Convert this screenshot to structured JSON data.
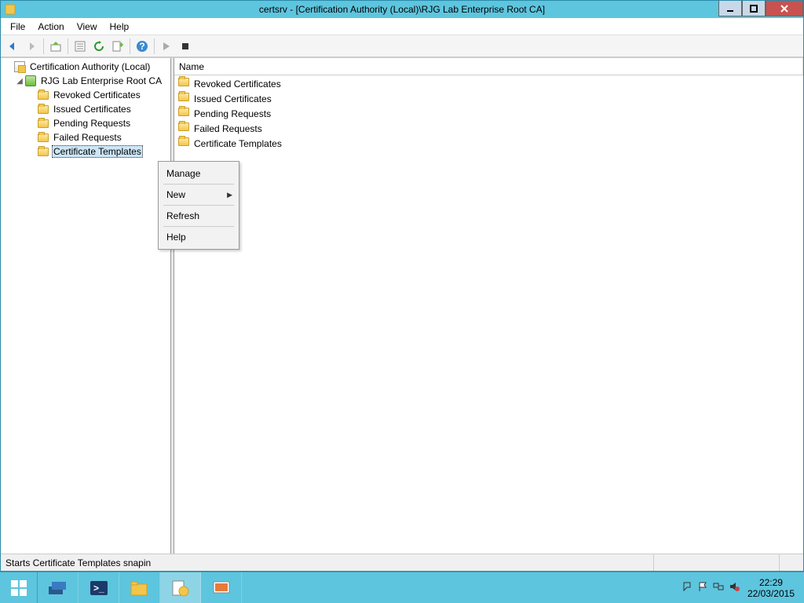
{
  "title": "certsrv - [Certification Authority (Local)\\RJG Lab Enterprise Root CA]",
  "menubar": {
    "file": "File",
    "action": "Action",
    "view": "View",
    "help": "Help"
  },
  "tree": {
    "root": "Certification Authority (Local)",
    "ca": "RJG Lab Enterprise Root CA",
    "children": {
      "revoked": "Revoked Certificates",
      "issued": "Issued Certificates",
      "pending": "Pending Requests",
      "failed": "Failed Requests",
      "templates": "Certificate Templates"
    }
  },
  "list": {
    "header": {
      "name": "Name"
    },
    "items": {
      "revoked": "Revoked Certificates",
      "issued": "Issued Certificates",
      "pending": "Pending Requests",
      "failed": "Failed Requests",
      "templates": "Certificate Templates"
    }
  },
  "context_menu": {
    "manage": "Manage",
    "new": "New",
    "refresh": "Refresh",
    "help": "Help"
  },
  "status": "Starts Certificate Templates snapin",
  "taskbar": {
    "time": "22:29",
    "date": "22/03/2015"
  }
}
